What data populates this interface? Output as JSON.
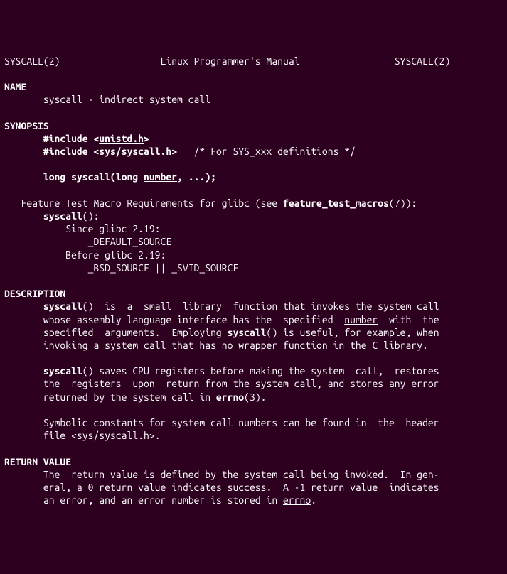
{
  "header": {
    "left": "SYSCALL(2)",
    "center": "Linux Programmer's Manual",
    "right": "SYSCALL(2)"
  },
  "sections": {
    "name": {
      "heading": "NAME",
      "body": "       syscall - indirect system call"
    },
    "synopsis": {
      "heading": "SYNOPSIS",
      "include1a": "       #include <",
      "include1b": "unistd.h",
      "include1c": ">",
      "include2a": "       #include <",
      "include2b": "sys/syscall.h",
      "include2c": ">   ",
      "include2comment": "/* For SYS_xxx definitions */",
      "protoa": "       long syscall(long ",
      "protob": "number",
      "protoc": ", ...);",
      "ftm_intro_a": "   Feature Test Macro Requirements for glibc (see ",
      "ftm_intro_b": "feature_test_macros",
      "ftm_intro_c": "(7)):",
      "ftm_fn_a": "       syscall",
      "ftm_fn_b": "():",
      "since": "           Since glibc 2.19:",
      "since_val": "               _DEFAULT_SOURCE",
      "before": "           Before glibc 2.19:",
      "before_val": "               _BSD_SOURCE || _SVID_SOURCE"
    },
    "description": {
      "heading": "DESCRIPTION",
      "p1_a": "       ",
      "p1_b": "syscall",
      "p1_c": "()  is  a  small  library  function that invokes the system call",
      "p2_a": "       whose assembly language interface has the  specified  ",
      "p2_b": "number",
      "p2_c": "  with  the",
      "p3_a": "       specified  arguments.  Employing ",
      "p3_b": "syscall",
      "p3_c": "() is useful, for example, when",
      "p4": "       invoking a system call that has no wrapper function in the C library.",
      "p5_a": "       ",
      "p5_b": "syscall",
      "p5_c": "() saves CPU registers before making the system  call,  restores",
      "p6": "       the  registers  upon  return from the system call, and stores any error",
      "p7_a": "       returned by the system call in ",
      "p7_b": "errno",
      "p7_c": "(3).",
      "p8": "       Symbolic constants for system call numbers can be found in  the  header",
      "p9_a": "       file ",
      "p9_b": "<sys/syscall.h>",
      "p9_c": "."
    },
    "return": {
      "heading": "RETURN VALUE",
      "p1": "       The  return value is defined by the system call being invoked.  In gen-",
      "p2": "       eral, a 0 return value indicates success.  A -1 return value  indicates",
      "p3_a": "       an error, and an error number is stored in ",
      "p3_b": "errno",
      "p3_c": "."
    }
  }
}
